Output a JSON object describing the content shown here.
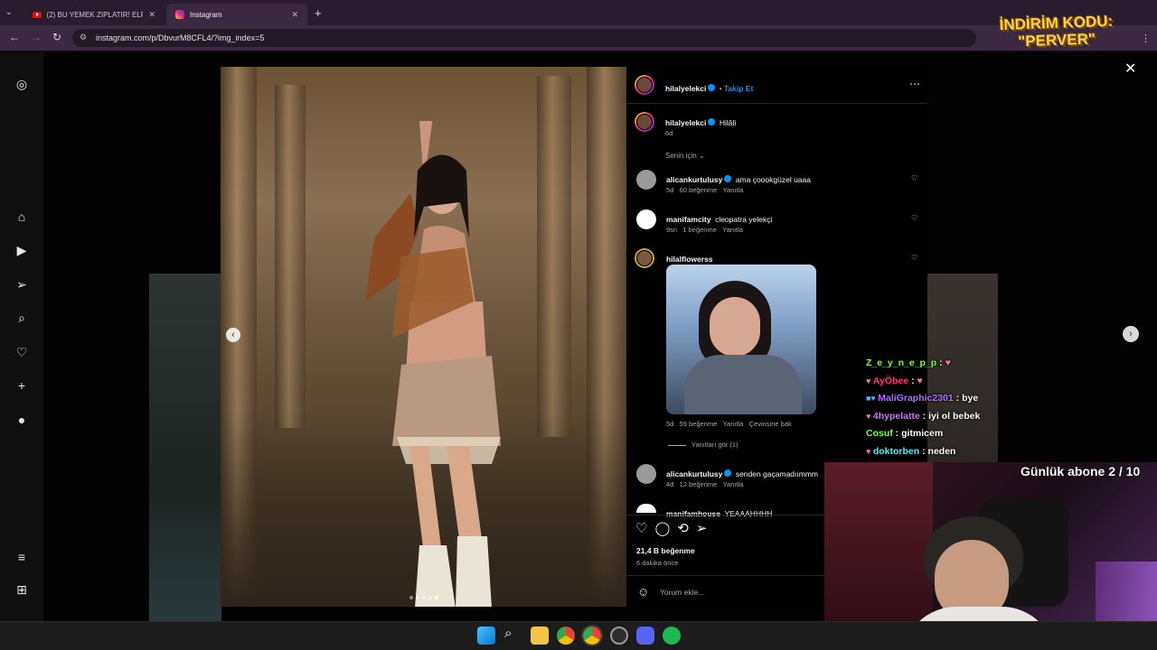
{
  "browser": {
    "tabs": [
      {
        "title": "(2) BU YEMEK ZIPLATIR! ELRAE",
        "active": false
      },
      {
        "title": "Instagram",
        "active": true
      }
    ],
    "url": "instagram.com/p/DbvurM8CFL4/?img_index=5"
  },
  "post": {
    "author": "hilalyelekci",
    "follow_label": "Takip Et",
    "caption": "Hilâli",
    "caption_time": "6d",
    "filter_label": "Senin için",
    "likes": "21,4 B beğenme",
    "posted": "6 dakika önce",
    "comment_placeholder": "Yorum ekle...",
    "comments": [
      {
        "user": "alicankurtulusy",
        "verified": true,
        "text": "ama çoookgüzel uaaa",
        "time": "5d",
        "likes": "60 beğenme",
        "reply": "Yanıtla"
      },
      {
        "user": "manifamcity",
        "verified": false,
        "text": "cleopatra yelekçi",
        "time": "9sn",
        "likes": "1 beğenme",
        "reply": "Yanıtla"
      },
      {
        "user": "hilalflowerss",
        "verified": false,
        "text": "",
        "time": "5d",
        "likes": "59 beğenme",
        "reply": "Yanıtla",
        "translate": "Çevirisine bak",
        "view_replies": "Yanıtları gör (1)"
      },
      {
        "user": "alicankurtulusy",
        "verified": true,
        "text": "senden gaçamadıımmm",
        "time": "4d",
        "likes": "12 beğenme",
        "reply": "Yanıtla"
      },
      {
        "user": "manifamhouse",
        "verified": false,
        "text": "YEAAAHHHH"
      }
    ]
  },
  "stream": {
    "promo": "İNDİRİM KODU:\n\"PERVER\"",
    "subs_goal": "Günlük abone 2 / 10",
    "chat": [
      {
        "user": "Z_e_y_n_e_p_p",
        "text": "",
        "color": "#7cff4a"
      },
      {
        "user": "AyÖbee",
        "text": "",
        "color": "#ff3b6b"
      },
      {
        "user": "MaliGraphic2301",
        "text": "bye",
        "color": "#b06cff"
      },
      {
        "user": "4hypelatte",
        "text": "iyi ol bebek",
        "color": "#d36cff"
      },
      {
        "user": "Cosuf",
        "text": "gitmicem",
        "color": "#7cff4a"
      },
      {
        "user": "doktorben",
        "text": "neden",
        "color": "#4af0ff"
      }
    ]
  }
}
